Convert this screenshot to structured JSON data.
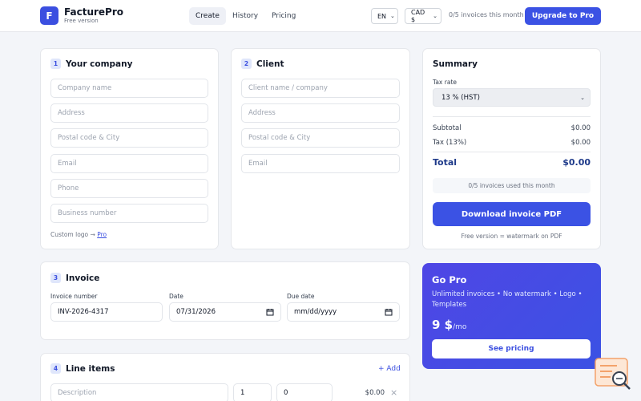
{
  "header": {
    "logo_letter": "F",
    "brand": "FacturePro",
    "plan": "Free version",
    "nav": [
      "Create",
      "History",
      "Pricing"
    ],
    "language": "EN",
    "currency": "CAD $",
    "quota": "0/5 invoices this month",
    "upgrade_label": "Upgrade to Pro"
  },
  "company": {
    "number": "1",
    "title": "Your company",
    "placeholders": [
      "Company name",
      "Address",
      "Postal code & City",
      "Email",
      "Phone",
      "Business number"
    ],
    "logo_note": "Custom logo →",
    "logo_link": "Pro"
  },
  "client": {
    "number": "2",
    "title": "Client",
    "placeholders": [
      "Client name / company",
      "Address",
      "Postal code & City",
      "Email"
    ]
  },
  "invoice": {
    "number": "3",
    "title": "Invoice",
    "number_label": "Invoice number",
    "number_value": "INV-2026-4317",
    "date_label": "Date",
    "date_value": "07/31/2026",
    "due_label": "Due date",
    "due_value": "mm/dd/yyyy"
  },
  "line_items": {
    "number": "4",
    "title": "Line items",
    "add_label": "+ Add",
    "description_placeholder": "Description",
    "quantity": "1",
    "price": "0",
    "amount": "$0.00",
    "remove": "×"
  },
  "summary": {
    "title": "Summary",
    "tax_rate_label": "Tax rate",
    "tax_rate_value": "13 % (HST)",
    "subtotal_label": "Subtotal",
    "subtotal_value": "$0.00",
    "tax_label": "Tax (13%)",
    "tax_value": "$0.00",
    "total_label": "Total",
    "total_value": "$0.00",
    "used_note": "0/5 invoices used this month",
    "download_label": "Download invoice PDF",
    "watermark_note": "Free version = watermark on PDF"
  },
  "pro": {
    "title": "Go Pro",
    "description": "Unlimited invoices • No watermark • Logo • Templates",
    "price": "9 $",
    "period": "/mo",
    "button": "See pricing"
  },
  "colors": {
    "accent": "#3b52e4",
    "accent_light": "#dfe6fb",
    "total_text": "#1e3a8a",
    "background": "#f3f5f9"
  }
}
